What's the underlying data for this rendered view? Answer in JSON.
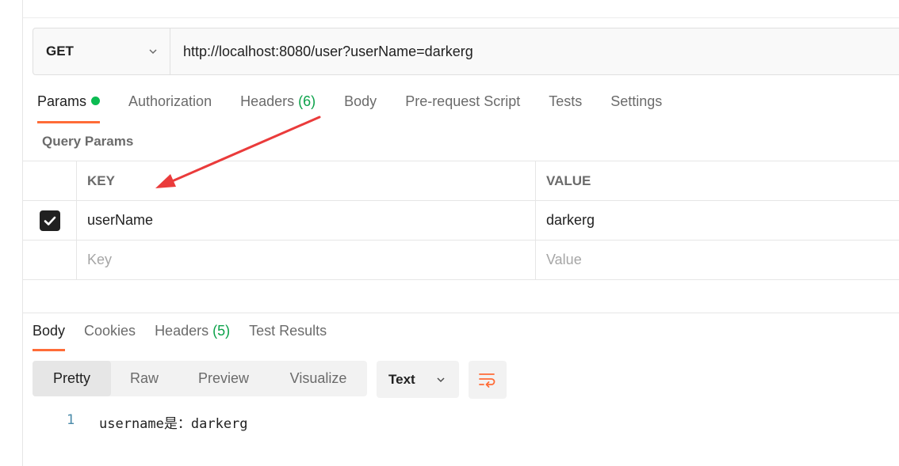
{
  "request": {
    "method": "GET",
    "url": "http://localhost:8080/user?userName=darkerg"
  },
  "request_tabs": [
    {
      "label": "Params",
      "active": true,
      "dot": true
    },
    {
      "label": "Authorization"
    },
    {
      "label": "Headers",
      "count": "(6)"
    },
    {
      "label": "Body"
    },
    {
      "label": "Pre-request Script"
    },
    {
      "label": "Tests"
    },
    {
      "label": "Settings"
    }
  ],
  "query_params": {
    "title": "Query Params",
    "headers": {
      "key": "KEY",
      "value": "VALUE"
    },
    "rows": [
      {
        "checked": true,
        "key": "userName",
        "value": "darkerg"
      }
    ],
    "placeholder": {
      "key": "Key",
      "value": "Value"
    }
  },
  "response_tabs": [
    {
      "label": "Body",
      "active": true
    },
    {
      "label": "Cookies"
    },
    {
      "label": "Headers",
      "count": "(5)"
    },
    {
      "label": "Test Results"
    }
  ],
  "response_view": {
    "options": [
      "Pretty",
      "Raw",
      "Preview",
      "Visualize"
    ],
    "selected": "Pretty",
    "format": "Text"
  },
  "response_body": {
    "lines": [
      {
        "number": "1",
        "text": "username是：darkerg"
      }
    ]
  },
  "colors": {
    "accent": "#ff6c37",
    "status_green": "#0cbb52",
    "annotation_arrow": "#ea3b3b"
  },
  "icons": {
    "method_dropdown": "chevron-down-icon",
    "format_dropdown": "chevron-down-icon",
    "wrap": "wrap-lines-icon",
    "checkbox": "checkmark-icon",
    "annotation": "arrow-annotation"
  }
}
